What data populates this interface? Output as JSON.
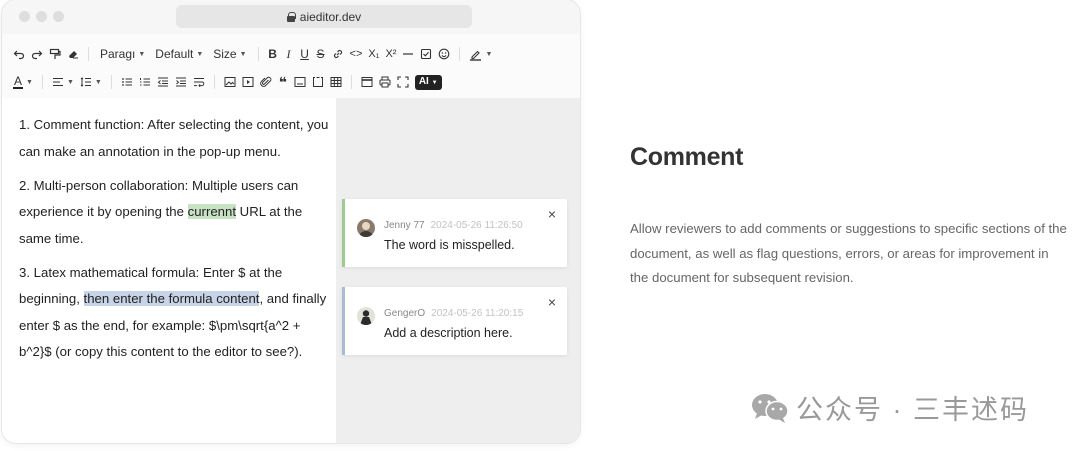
{
  "browser": {
    "url": "aieditor.dev"
  },
  "toolbar": {
    "row1": {
      "undo_icon": "undo-icon",
      "redo_icon": "redo-icon",
      "paragraph_label": "Paragı",
      "font_label": "Default",
      "size_label": "Size",
      "bold": "B",
      "italic": "I",
      "underline": "U",
      "strike": "S",
      "code": "<>",
      "subscript": "X₁",
      "superscript": "X²"
    },
    "row2": {
      "ai_label": "AI"
    }
  },
  "editor": {
    "p1": "1. Comment function: After selecting the content, you can make an annotation in the pop-up menu.",
    "p2_before": "2. Multi-person collaboration: Multiple users can experience it by opening the ",
    "p2_highlight": "currennt",
    "p2_after": " URL at the same time.",
    "p3_before": "3. Latex mathematical formula: Enter $ at the beginning, ",
    "p3_highlight": "then enter the formula content",
    "p3_after": ", and finally enter $ as the end, for example: $\\pm\\sqrt{a^2 + b^2}$ (or copy this content to the editor to see?)."
  },
  "comments": [
    {
      "author": "Jenny 77",
      "time": "2024-05-26 11:26:50",
      "text": "The word is misspelled.",
      "accent": "#9ccd8f"
    },
    {
      "author": "GengerO",
      "time": "2024-05-26 11:20:15",
      "text": "Add a description here.",
      "accent": "#a9b9d6"
    }
  ],
  "feature": {
    "title": "Comment",
    "description": "Allow reviewers to add comments or suggestions to specific sections of the document, as well as flag questions, errors, or areas for improvement in the document for subsequent revision."
  },
  "watermark": {
    "text": "公众号 · 三丰述码"
  }
}
